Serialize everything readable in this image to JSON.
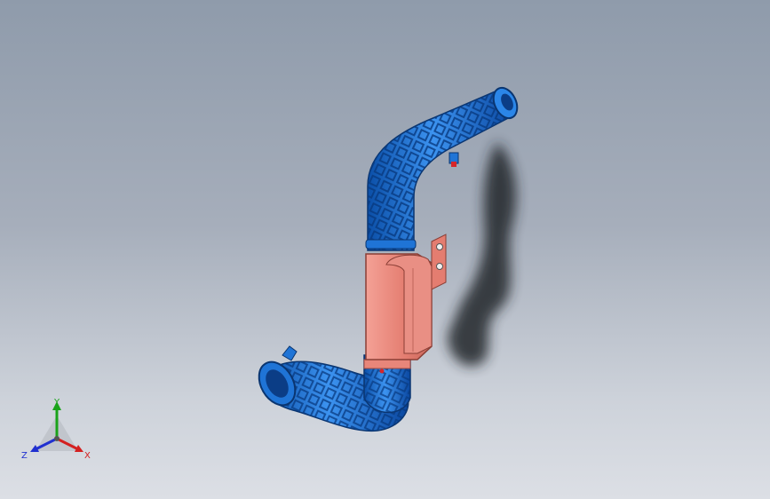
{
  "viewport": {
    "background_top": "#8f9bab",
    "background_bottom": "#dcdfe5"
  },
  "model": {
    "pipe_color": "#1f74d6",
    "pipe_rib_color": "#0a3f86",
    "bracket_color": "#e8867a",
    "accent_color": "#d6262a",
    "shadow_color": "#2a2d33"
  },
  "triad": {
    "x_label": "X",
    "y_label": "Y",
    "z_label": "Z",
    "x_color": "#d42020",
    "y_color": "#1aa31a",
    "z_color": "#2030d0"
  }
}
